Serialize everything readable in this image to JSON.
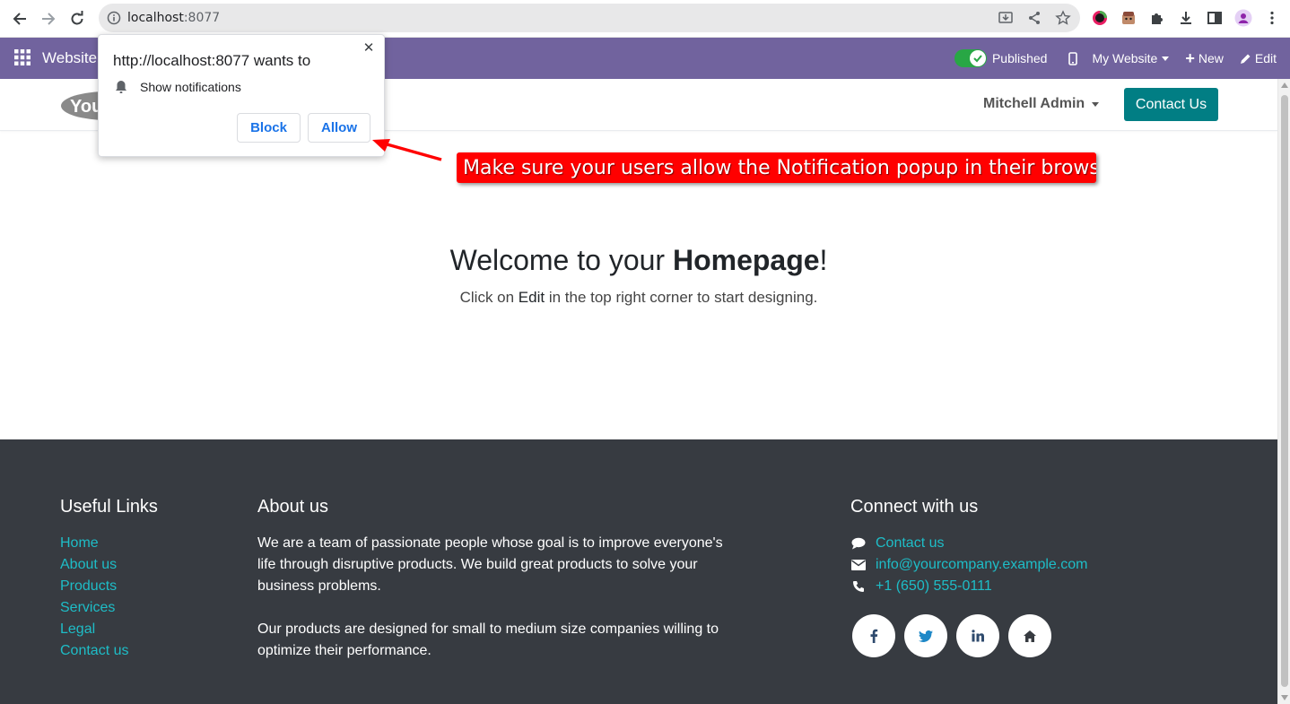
{
  "browser": {
    "url_host": "localhost",
    "url_port": ":8077"
  },
  "odoo_bar": {
    "app_name": "Website",
    "published_label": "Published",
    "website_menu": "My Website",
    "new_label": "New",
    "edit_label": "Edit"
  },
  "header": {
    "user_menu": "Mitchell Admin",
    "contact_button": "Contact Us"
  },
  "main": {
    "welcome_prefix": "Welcome to your ",
    "welcome_bold": "Homepage",
    "welcome_suffix": "!",
    "sub_prefix": "Click on ",
    "sub_bold": "Edit",
    "sub_suffix": " in the top right corner to start designing."
  },
  "footer": {
    "useful_links_title": "Useful Links",
    "useful_links": [
      "Home",
      "About us",
      "Products",
      "Services",
      "Legal",
      "Contact us"
    ],
    "about_title": "About us",
    "about_p1": "We are a team of passionate people whose goal is to improve everyone's life through disruptive products. We build great products to solve your business problems.",
    "about_p2": "Our products are designed for small to medium size companies willing to optimize their performance.",
    "connect_title": "Connect with us",
    "connect_items": [
      {
        "icon": "comment-icon",
        "text": "Contact us"
      },
      {
        "icon": "envelope-icon",
        "text": "info@yourcompany.example.com"
      },
      {
        "icon": "phone-icon",
        "text": "+1 (650) 555-0111"
      }
    ],
    "social": [
      {
        "icon": "facebook-icon",
        "glyph": "f"
      },
      {
        "icon": "twitter-icon",
        "glyph": "t"
      },
      {
        "icon": "linkedin-icon",
        "glyph": "in"
      },
      {
        "icon": "home-icon",
        "glyph": ""
      }
    ]
  },
  "popup": {
    "title": "http://localhost:8077 wants to",
    "permission": "Show notifications",
    "block_label": "Block",
    "allow_label": "Allow"
  },
  "annotation": {
    "text": "Make sure your users allow the Notification popup in their browsers."
  },
  "colors": {
    "odoo_purple": "#71639e",
    "teal": "#017e84",
    "footer_bg": "#373b41",
    "link": "#1ebdc7",
    "callout": "#ff0000"
  }
}
